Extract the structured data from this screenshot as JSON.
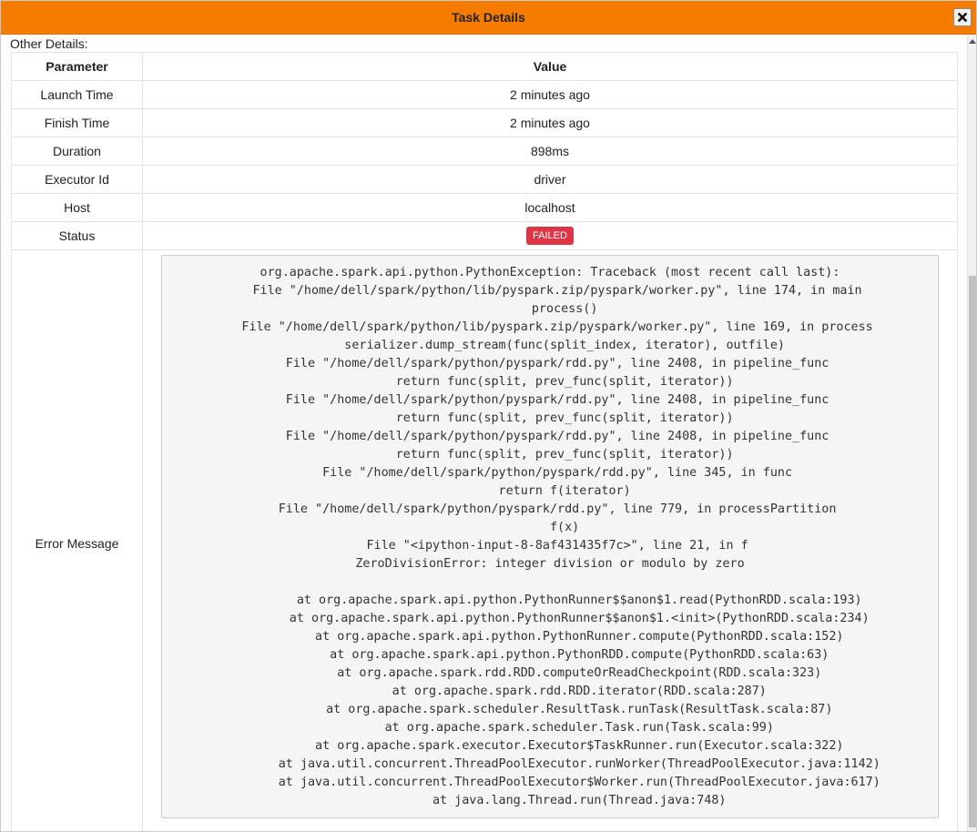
{
  "dialog": {
    "title": "Task Details",
    "close_icon": "close-x-icon"
  },
  "section_label": "Other Details:",
  "table": {
    "headers": {
      "parameter": "Parameter",
      "value": "Value"
    },
    "rows": [
      {
        "param": "Launch Time",
        "value": "2 minutes ago"
      },
      {
        "param": "Finish Time",
        "value": "2 minutes ago"
      },
      {
        "param": "Duration",
        "value": "898ms"
      },
      {
        "param": "Executor Id",
        "value": "driver"
      },
      {
        "param": "Host",
        "value": "localhost"
      }
    ],
    "status": {
      "param": "Status",
      "value": "FAILED",
      "color": "#dc3545"
    },
    "error": {
      "param": "Error Message",
      "value": "org.apache.spark.api.python.PythonException: Traceback (most recent call last):\n  File \"/home/dell/spark/python/lib/pyspark.zip/pyspark/worker.py\", line 174, in main\n    process()\n  File \"/home/dell/spark/python/lib/pyspark.zip/pyspark/worker.py\", line 169, in process\n    serializer.dump_stream(func(split_index, iterator), outfile)\n  File \"/home/dell/spark/python/pyspark/rdd.py\", line 2408, in pipeline_func\n    return func(split, prev_func(split, iterator))\n  File \"/home/dell/spark/python/pyspark/rdd.py\", line 2408, in pipeline_func\n    return func(split, prev_func(split, iterator))\n  File \"/home/dell/spark/python/pyspark/rdd.py\", line 2408, in pipeline_func\n    return func(split, prev_func(split, iterator))\n  File \"/home/dell/spark/python/pyspark/rdd.py\", line 345, in func\n    return f(iterator)\n  File \"/home/dell/spark/python/pyspark/rdd.py\", line 779, in processPartition\n    f(x)\n  File \"<ipython-input-8-8af431435f7c>\", line 21, in f\nZeroDivisionError: integer division or modulo by zero\n\n\tat org.apache.spark.api.python.PythonRunner$$anon$1.read(PythonRDD.scala:193)\n\tat org.apache.spark.api.python.PythonRunner$$anon$1.<init>(PythonRDD.scala:234)\n\tat org.apache.spark.api.python.PythonRunner.compute(PythonRDD.scala:152)\n\tat org.apache.spark.api.python.PythonRDD.compute(PythonRDD.scala:63)\n\tat org.apache.spark.rdd.RDD.computeOrReadCheckpoint(RDD.scala:323)\n\tat org.apache.spark.rdd.RDD.iterator(RDD.scala:287)\n\tat org.apache.spark.scheduler.ResultTask.runTask(ResultTask.scala:87)\n\tat org.apache.spark.scheduler.Task.run(Task.scala:99)\n\tat org.apache.spark.executor.Executor$TaskRunner.run(Executor.scala:322)\n\tat java.util.concurrent.ThreadPoolExecutor.runWorker(ThreadPoolExecutor.java:1142)\n\tat java.util.concurrent.ThreadPoolExecutor$Worker.run(ThreadPoolExecutor.java:617)\n\tat java.lang.Thread.run(Thread.java:748)"
    }
  },
  "colors": {
    "titlebar": "#f57c00",
    "failed_badge": "#dc3545",
    "error_box_bg": "#f5f5f5"
  }
}
